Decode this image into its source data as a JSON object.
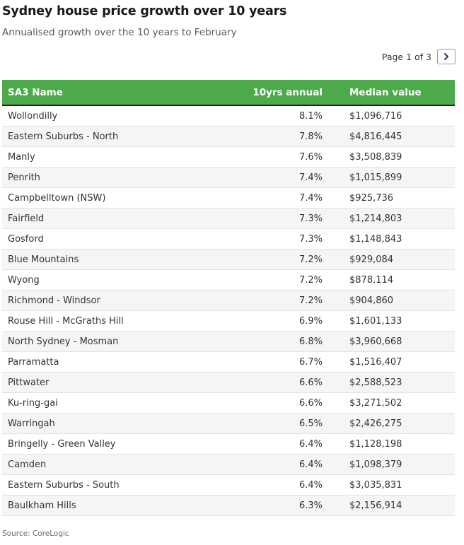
{
  "title": "Sydney house price growth over 10 years",
  "subtitle": "Annualised growth over the 10 years to February",
  "pager": {
    "label": "Page 1 of 3",
    "next_icon": "chevron-right-icon"
  },
  "source": "Source: CoreLogic",
  "colors": {
    "header_bg": "#4caa4a",
    "header_text": "#ffffff",
    "stripe": "#f5f5f5"
  },
  "chart_data": {
    "type": "table",
    "columns": [
      "SA3 Name",
      "10yrs annual",
      "Median value"
    ],
    "rows": [
      [
        "Wollondilly",
        "8.1%",
        "$1,096,716"
      ],
      [
        "Eastern Suburbs - North",
        "7.8%",
        "$4,816,445"
      ],
      [
        "Manly",
        "7.6%",
        "$3,508,839"
      ],
      [
        "Penrith",
        "7.4%",
        "$1,015,899"
      ],
      [
        "Campbelltown (NSW)",
        "7.4%",
        "$925,736"
      ],
      [
        "Fairfield",
        "7.3%",
        "$1,214,803"
      ],
      [
        "Gosford",
        "7.3%",
        "$1,148,843"
      ],
      [
        "Blue Mountains",
        "7.2%",
        "$929,084"
      ],
      [
        "Wyong",
        "7.2%",
        "$878,114"
      ],
      [
        "Richmond - Windsor",
        "7.2%",
        "$904,860"
      ],
      [
        "Rouse Hill - McGraths Hill",
        "6.9%",
        "$1,601,133"
      ],
      [
        "North Sydney - Mosman",
        "6.8%",
        "$3,960,668"
      ],
      [
        "Parramatta",
        "6.7%",
        "$1,516,407"
      ],
      [
        "Pittwater",
        "6.6%",
        "$2,588,523"
      ],
      [
        "Ku-ring-gai",
        "6.6%",
        "$3,271,502"
      ],
      [
        "Warringah",
        "6.5%",
        "$2,426,275"
      ],
      [
        "Bringelly - Green Valley",
        "6.4%",
        "$1,128,198"
      ],
      [
        "Camden",
        "6.4%",
        "$1,098,379"
      ],
      [
        "Eastern Suburbs - South",
        "6.4%",
        "$3,035,831"
      ],
      [
        "Baulkham Hills",
        "6.3%",
        "$2,156,914"
      ]
    ]
  }
}
